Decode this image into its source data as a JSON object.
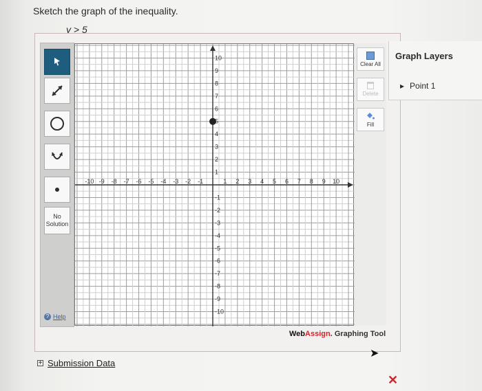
{
  "question": {
    "prompt": "Sketch the graph of the inequality.",
    "inequality": "y > 5"
  },
  "toolbar": {
    "no_solution_label_1": "No",
    "no_solution_label_2": "Solution",
    "help_label": "Help"
  },
  "controls": {
    "clear_all": "Clear All",
    "delete": "Delete",
    "fill": "Fill"
  },
  "graph": {
    "x_ticks": [
      "-10",
      "-9",
      "-8",
      "-7",
      "-6",
      "-5",
      "-4",
      "-3",
      "-2",
      "-1",
      "1",
      "2",
      "3",
      "4",
      "5",
      "6",
      "7",
      "8",
      "9",
      "10"
    ],
    "y_ticks": [
      "10",
      "9",
      "8",
      "7",
      "6",
      "5",
      "4",
      "3",
      "2",
      "1",
      "-1",
      "-2",
      "-3",
      "-4",
      "-5",
      "-6",
      "-7",
      "-8",
      "-9",
      "-10"
    ],
    "x_range": [
      -10,
      10
    ],
    "y_range": [
      -10,
      10
    ],
    "point": {
      "x": 0,
      "y": 5
    }
  },
  "brand": {
    "web": "Web",
    "assign": "Assign",
    "suffix": ". Graphing Tool"
  },
  "layers": {
    "title": "Graph Layers",
    "items": [
      {
        "label": "Point 1"
      }
    ]
  },
  "footer": {
    "submission_label": "Submission Data"
  },
  "colors": {
    "selected_tool": "#1f5d7f",
    "brand_red": "#d1242f",
    "error": "#e31b23"
  }
}
